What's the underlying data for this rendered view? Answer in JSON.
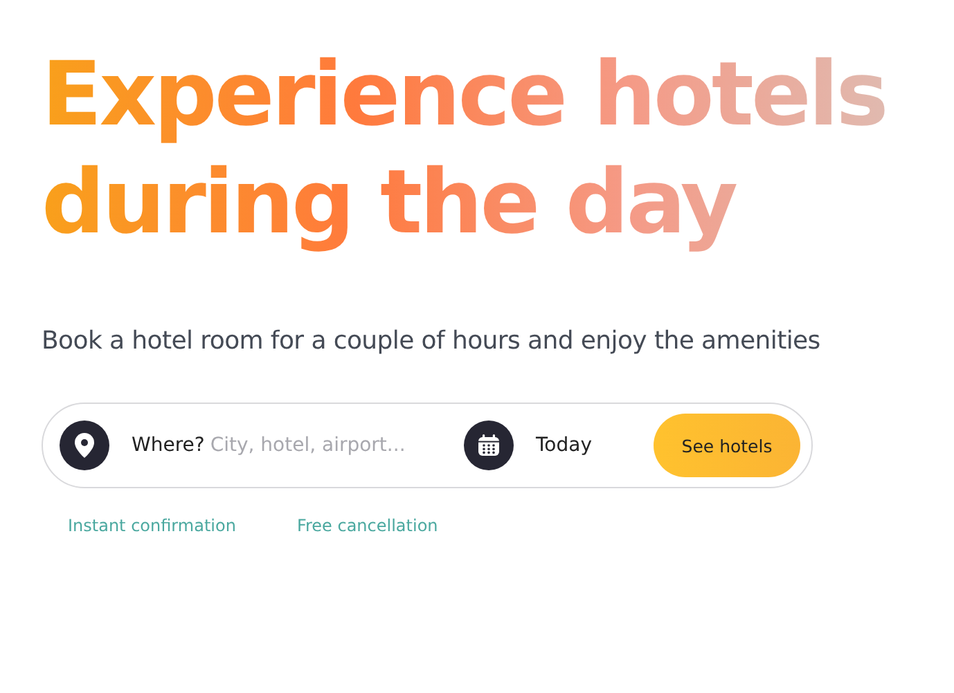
{
  "hero": {
    "title": "Experience hotels during the day",
    "subtitle": "Book a hotel room for a couple of hours and enjoy the amenities"
  },
  "search": {
    "location_label": "Where?",
    "location_placeholder": "City, hotel, airport...",
    "date": "Today",
    "button": "See hotels"
  },
  "features": [
    "Instant confirmation",
    "Free cancellation"
  ]
}
